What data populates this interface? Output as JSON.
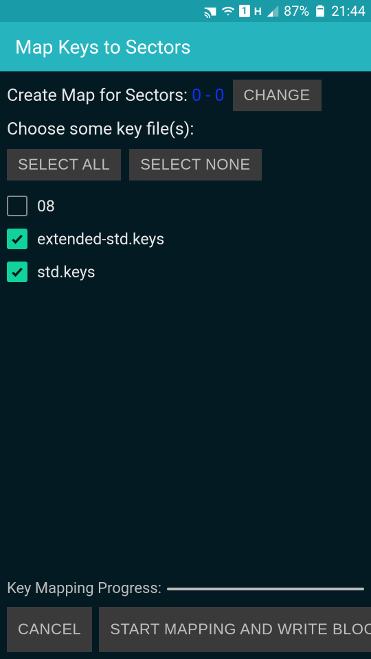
{
  "status_bar": {
    "battery_pct": "87%",
    "clock": "21:44",
    "network_letter": "H",
    "sim_number": "1"
  },
  "app_bar": {
    "title": "Map Keys to Sectors"
  },
  "sectors": {
    "label": "Create Map for Sectors:",
    "range": "0 - 0",
    "change_btn": "CHANGE"
  },
  "choose_label": "Choose some key file(s):",
  "select_all_btn": "SELECT ALL",
  "select_none_btn": "SELECT NONE",
  "keys": [
    {
      "label": "08",
      "checked": false
    },
    {
      "label": "extended-std.keys",
      "checked": true
    },
    {
      "label": "std.keys",
      "checked": true
    }
  ],
  "progress_label": "Key Mapping Progress:",
  "cancel_btn": "CANCEL",
  "start_btn": "START MAPPING AND WRITE BLOCK"
}
